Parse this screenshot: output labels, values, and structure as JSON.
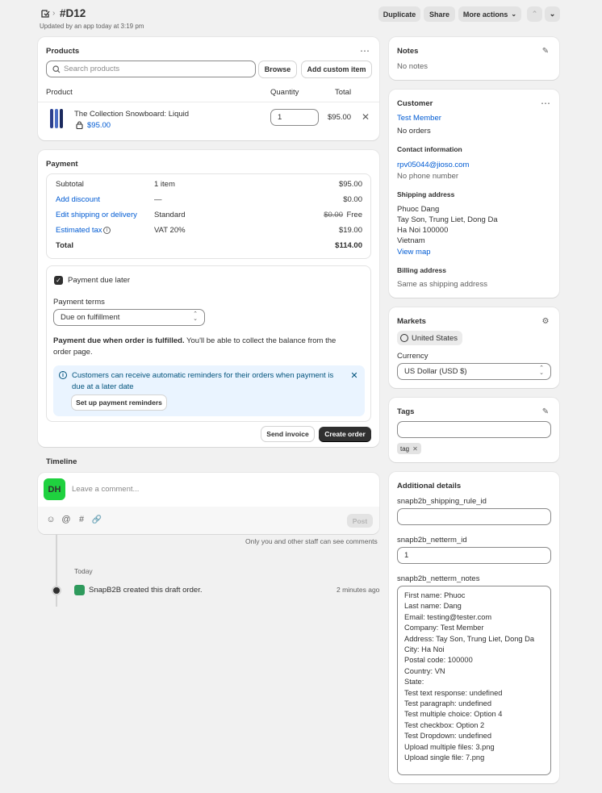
{
  "header": {
    "title": "#D12",
    "subtitle": "Updated by an app today at 3:19 pm",
    "duplicate": "Duplicate",
    "share": "Share",
    "more_actions": "More actions"
  },
  "products": {
    "title": "Products",
    "search_placeholder": "Search products",
    "browse": "Browse",
    "add_custom": "Add custom item",
    "col_product": "Product",
    "col_quantity": "Quantity",
    "col_total": "Total",
    "item": {
      "name": "The Collection Snowboard: Liquid",
      "price": "$95.00",
      "quantity": "1",
      "total": "$95.00"
    }
  },
  "payment": {
    "title": "Payment",
    "rows": [
      {
        "label": "Subtotal",
        "middle": "1 item",
        "value": "$95.00",
        "link": false
      },
      {
        "label": "Add discount",
        "middle": "—",
        "value": "$0.00",
        "link": true
      },
      {
        "label": "Edit shipping or delivery",
        "middle": "Standard",
        "strike": "$0.00",
        "value": "Free",
        "link": true
      },
      {
        "label": "Estimated tax",
        "middle": "VAT 20%",
        "value": "$19.00",
        "link": true
      },
      {
        "label": "Total",
        "middle": "",
        "value": "$114.00",
        "link": false
      }
    ],
    "due_later": "Payment due later",
    "terms_label": "Payment terms",
    "terms_value": "Due on fulfillment",
    "desc_bold": "Payment due when order is fulfilled.",
    "desc_rest": " You'll be able to collect the balance from the order page.",
    "banner_text": "Customers can receive automatic reminders for their orders when payment is due at a later date",
    "banner_button": "Set up payment reminders",
    "send_invoice": "Send invoice",
    "create_order": "Create order"
  },
  "timeline": {
    "title": "Timeline",
    "avatar": "DH",
    "placeholder": "Leave a comment...",
    "post": "Post",
    "note": "Only you and other staff can see comments",
    "today": "Today",
    "event": "SnapB2B created this draft order.",
    "event_time": "2 minutes ago"
  },
  "notes": {
    "title": "Notes",
    "text": "No notes"
  },
  "customer": {
    "title": "Customer",
    "name": "Test Member",
    "orders": "No orders",
    "contact_title": "Contact information",
    "email": "rpv05044@jioso.com",
    "phone": "No phone number",
    "shipping_title": "Shipping address",
    "shipping_lines": [
      "Phuoc Dang",
      "Tay Son, Trung Liet, Dong Da",
      "Ha Noi 100000",
      "Vietnam"
    ],
    "view_map": "View map",
    "billing_title": "Billing address",
    "billing_text": "Same as shipping address"
  },
  "markets": {
    "title": "Markets",
    "market": "United States",
    "currency_label": "Currency",
    "currency": "US Dollar (USD $)"
  },
  "tags": {
    "title": "Tags",
    "tag": "tag"
  },
  "additional": {
    "title": "Additional details",
    "field1_label": "snapb2b_shipping_rule_id",
    "field1_value": "",
    "field2_label": "snapb2b_netterm_id",
    "field2_value": "1",
    "field3_label": "snapb2b_netterm_notes",
    "field3_value": "First name: Phuoc\nLast name: Dang\nEmail: testing@tester.com\nCompany: Test Member\nAddress: Tay Son, Trung Liet, Dong Da\nCity: Ha Noi\nPostal code: 100000\nCountry: VN\nState:\nTest text response: undefined\nTest paragraph: undefined\nTest multiple choice: Option 4\nTest checkbox: Option 2\nTest Dropdown: undefined\nUpload multiple files: 3.png\nUpload single file: 7.png"
  },
  "colors": {
    "link": "#005bd3",
    "avatar": "#1fd13f",
    "primary": "#303030",
    "banner": "#eaf4ff"
  }
}
